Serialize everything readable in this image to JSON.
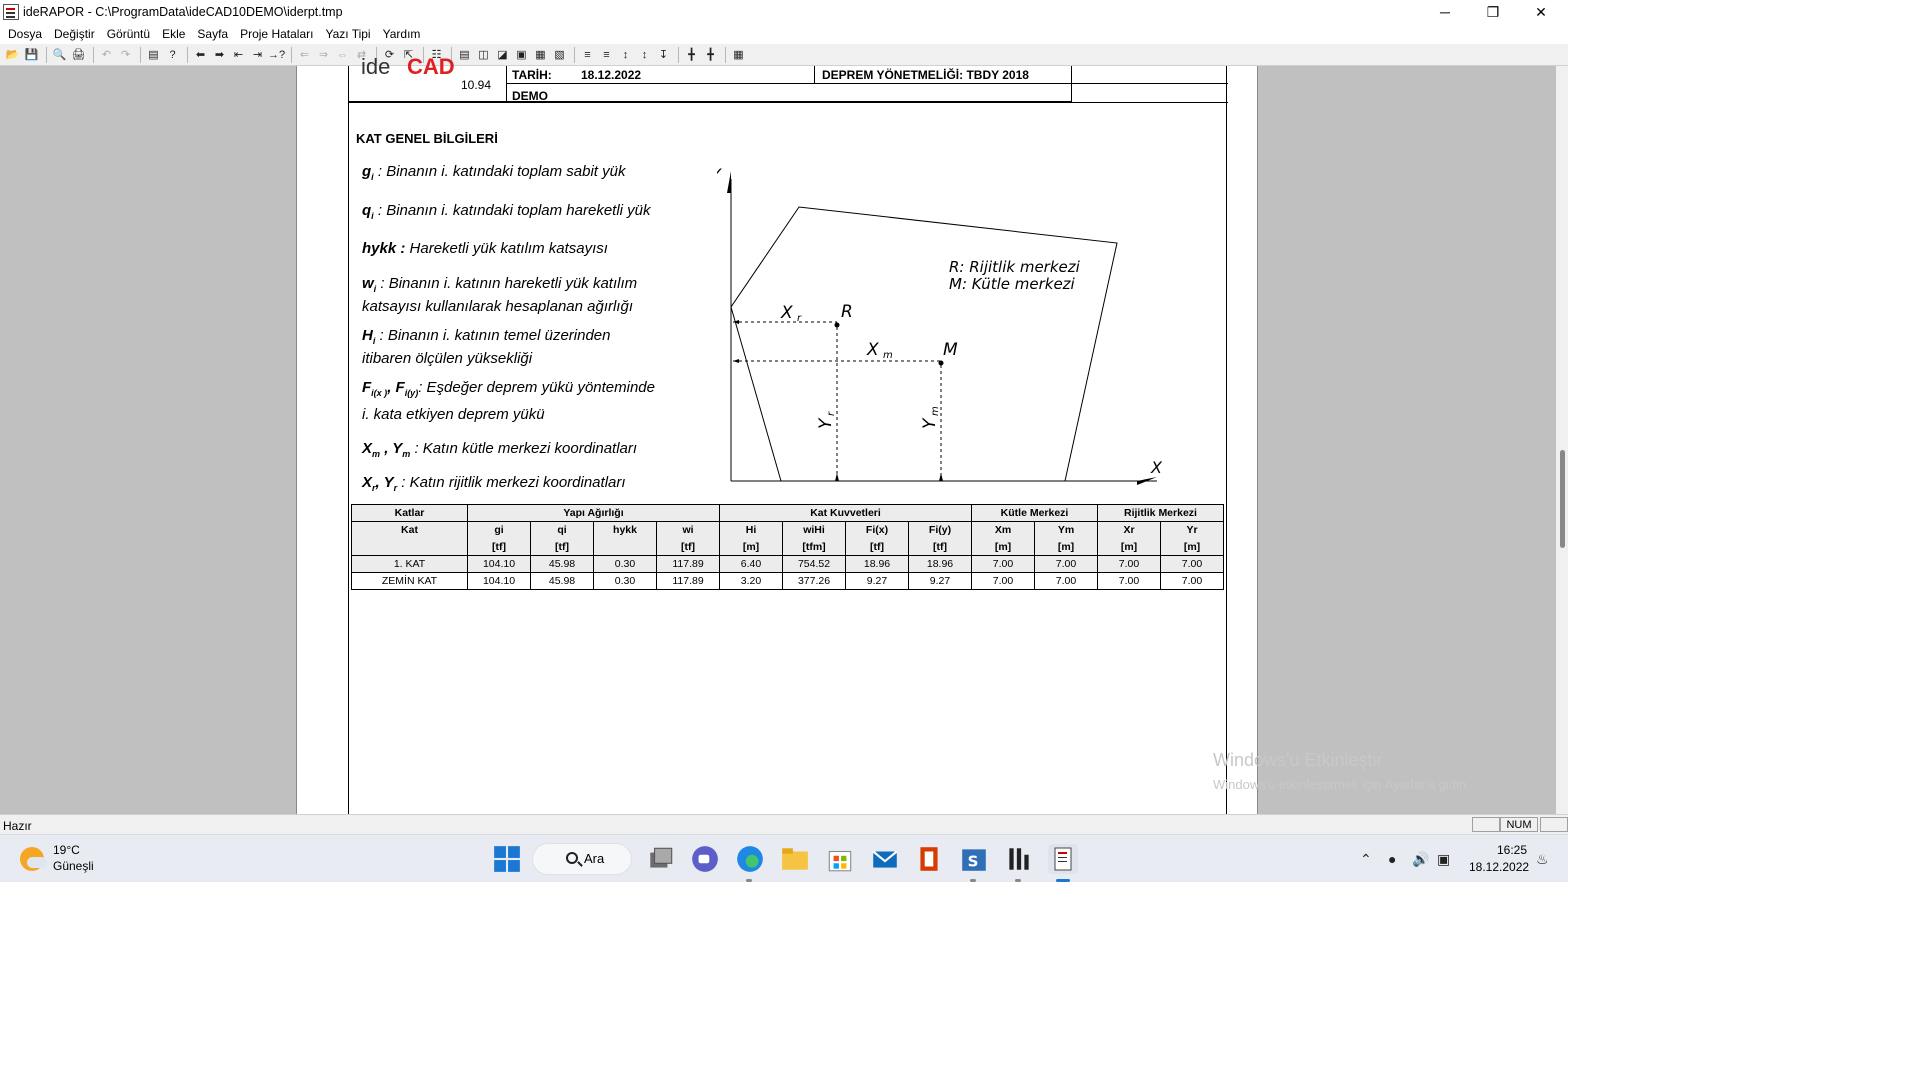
{
  "window": {
    "title": "ideRAPOR - C:\\ProgramData\\ideCAD10DEMO\\iderpt.tmp",
    "minimize": "─",
    "restore": "❐",
    "close": "✕"
  },
  "menu": [
    "Dosya",
    "Değiştir",
    "Görüntü",
    "Ekle",
    "Sayfa",
    "Proje Hataları",
    "Yazı Tipi",
    "Yardım"
  ],
  "report_header": {
    "logo_ide": "ide",
    "logo_cad": "CAD",
    "version": "10.94",
    "date_label": "TARİH:",
    "date_value": "18.12.2022",
    "regulation": "DEPREM YÖNETMELİĞİ: TBDY 2018",
    "demo": "DEMO"
  },
  "section_title": "KAT GENEL BİLGİLERİ",
  "legend": {
    "g_sym": "g",
    "g_sub": "i",
    "g_text": " : Binanın i. katındaki toplam sabit yük",
    "q_sym": "q",
    "q_sub": "i",
    "q_text": " : Binanın i. katındaki toplam hareketli yük",
    "hykk_sym": "hykk :",
    "hykk_text": " Hareketli yük katılım katsayısı",
    "w_sym": "w",
    "w_sub": "i",
    "w_text": " : Binanın i. katının hareketli yük katılım",
    "w_text2": "katsayısı kullanılarak hesaplanan ağırlığı",
    "h_sym": "H",
    "h_sub": "i",
    "h_text": " : Binanın i. katının temel üzerinden",
    "h_text2": "itibaren ölçülen yüksekliği",
    "f_sym": "F",
    "f_sub1": "i(x )",
    "f_mid": ", F",
    "f_sub2": "i(y)",
    "f_text": ": Eşdeğer deprem yükü yönteminde",
    "f_text2": "i. kata etkiyen deprem yükü",
    "m_sym1": "X",
    "m_sub1": "m",
    "m_mid": " , Y",
    "m_sub2": "m",
    "m_text": " : Katın kütle merkezi koordinatları",
    "r_sym1": "X",
    "r_sub1": "r",
    "r_mid": ", Y",
    "r_sub2": "r",
    "r_text": " : Katın rijitlik merkezi koordinatları"
  },
  "diagram": {
    "axis_y": "Y",
    "axis_x": "X",
    "legend_r": "R: Rijitlik merkezi",
    "legend_m": "M: Kütle merkezi",
    "label_xr": "X",
    "label_xr_sub": "r",
    "label_r": "R",
    "label_xm": "X",
    "label_xm_sub": "m",
    "label_m": "M",
    "label_yr": "Y",
    "label_yr_sub": "r",
    "label_ym": "Y",
    "label_ym_sub": "m"
  },
  "table": {
    "group_headers": [
      "Katlar",
      "Yapı Ağırlığı",
      "Kat Kuvvetleri",
      "Kütle Merkezi",
      "Rijitlik Merkezi"
    ],
    "columns": [
      "Kat",
      "gi",
      "qi",
      "hykk",
      "wi",
      "Hi",
      "wiHi",
      "Fi(x)",
      "Fi(y)",
      "Xm",
      "Ym",
      "Xr",
      "Yr"
    ],
    "units": [
      "",
      "[tf]",
      "[tf]",
      "",
      "[tf]",
      "[m]",
      "[tfm]",
      "[tf]",
      "[tf]",
      "[m]",
      "[m]",
      "[m]",
      "[m]"
    ],
    "rows": [
      [
        "1. KAT",
        "104.10",
        "45.98",
        "0.30",
        "117.89",
        "6.40",
        "754.52",
        "18.96",
        "18.96",
        "7.00",
        "7.00",
        "7.00",
        "7.00"
      ],
      [
        "ZEMİN KAT",
        "104.10",
        "45.98",
        "0.30",
        "117.89",
        "3.20",
        "377.26",
        "9.27",
        "9.27",
        "7.00",
        "7.00",
        "7.00",
        "7.00"
      ]
    ]
  },
  "watermark": {
    "line1": "Windows'u Etkinleştir",
    "line2": "Windows'u etkinleştirmek için Ayarlar'a gidin."
  },
  "status": {
    "text": "Hazır",
    "num": "NUM"
  },
  "taskbar": {
    "temperature": "19°C",
    "condition": "Güneşli",
    "search_label": "Ara",
    "time": "16:25",
    "date": "18.12.2022"
  }
}
